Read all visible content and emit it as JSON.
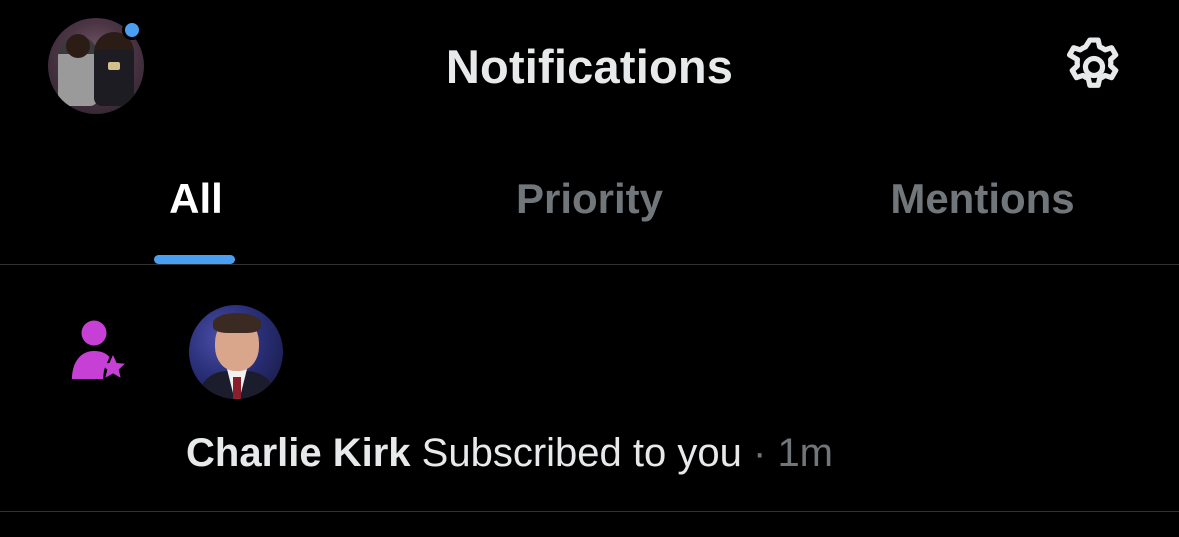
{
  "header": {
    "title": "Notifications",
    "avatar_icon": "profile-avatar",
    "settings_icon": "gear-icon"
  },
  "tabs": [
    {
      "label": "All",
      "active": true
    },
    {
      "label": "Priority",
      "active": false
    },
    {
      "label": "Mentions",
      "active": false
    }
  ],
  "notifications": [
    {
      "type_icon": "person-star-icon",
      "user_name": "Charlie Kirk",
      "action": "Subscribed to you",
      "separator": "·",
      "time": "1m"
    }
  ],
  "colors": {
    "background": "#000000",
    "accent": "#4a9ff0",
    "subscribe_icon": "#c640d6",
    "text_primary": "#e7e9ea",
    "text_secondary": "#71767b",
    "divider": "#2f3336"
  }
}
